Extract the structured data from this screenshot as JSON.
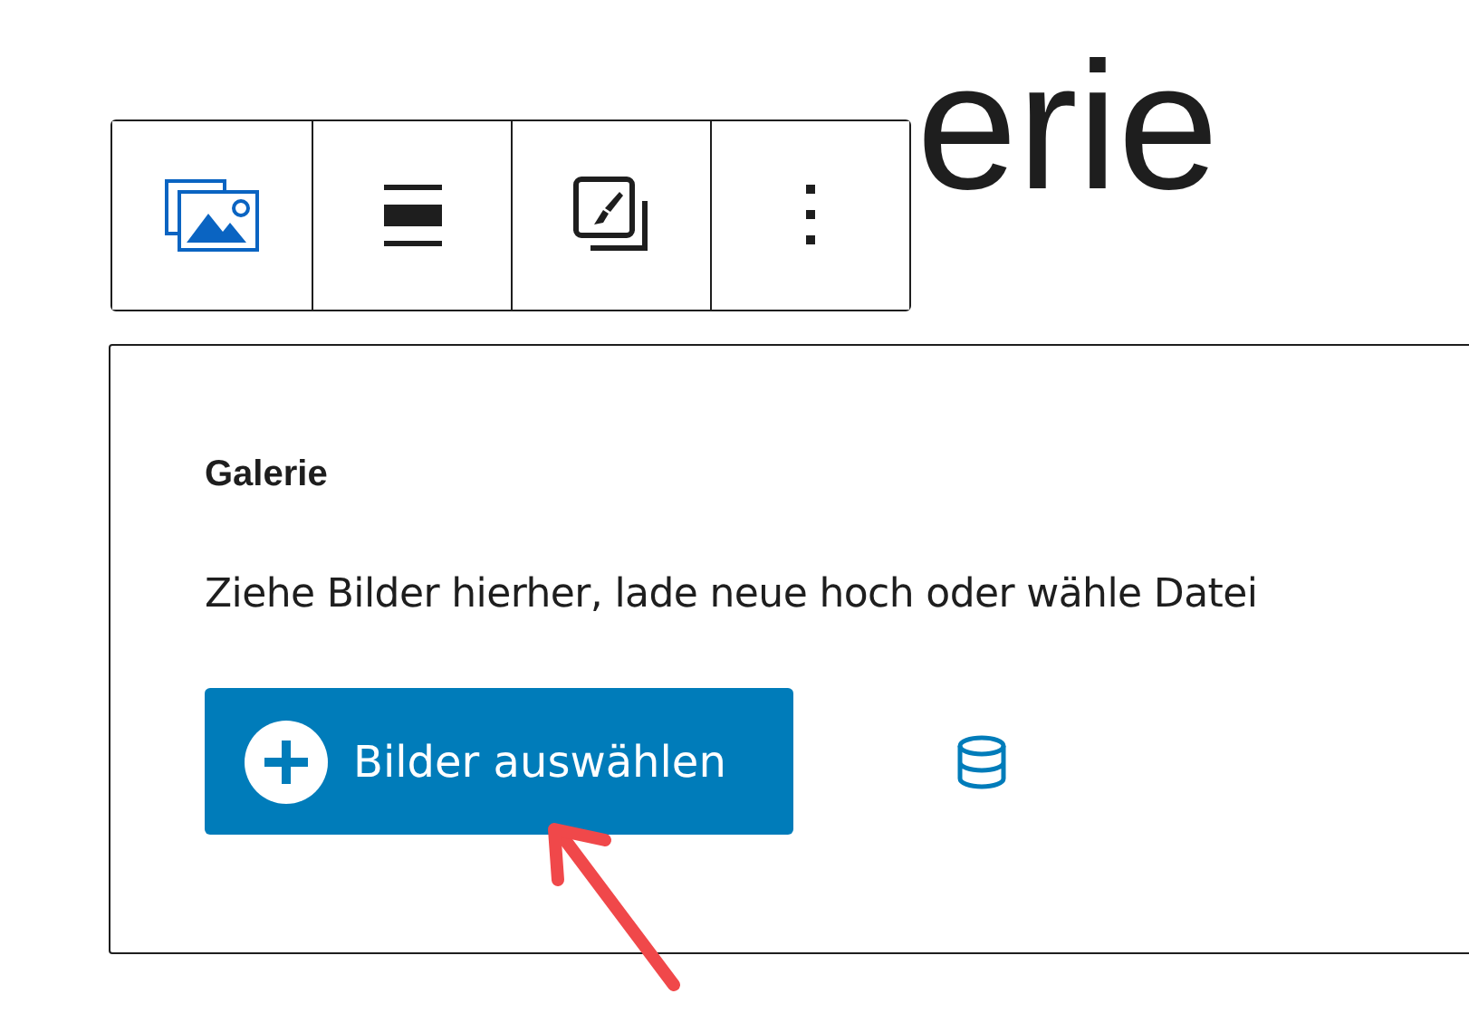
{
  "title": "erie",
  "toolbar": [
    {
      "kind": "gallery"
    },
    {
      "kind": "align"
    },
    {
      "kind": "styles"
    },
    {
      "kind": "more"
    }
  ],
  "placeholder_card": {
    "label": "Galerie",
    "instructions": "Ziehe Bilder hierher, lade neue hoch oder wähle Datei",
    "upload_button": "Bilder auswählen"
  }
}
